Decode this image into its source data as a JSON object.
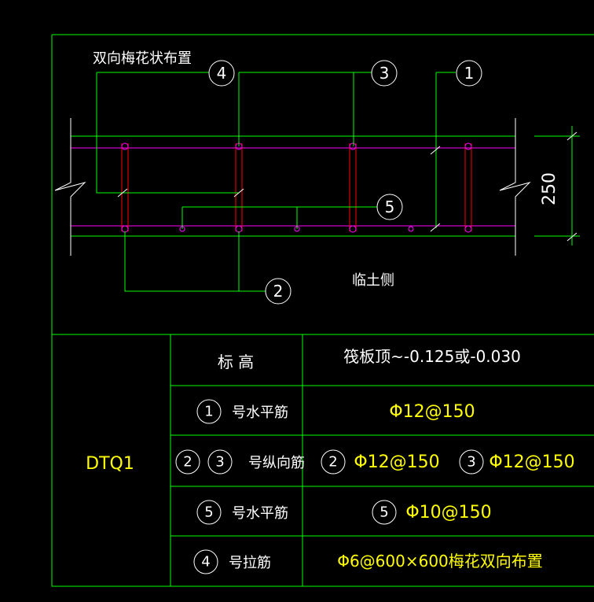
{
  "drawing": {
    "layout_note": "双向梅花状布置",
    "soil_side": "临土侧",
    "dimension": "250",
    "callouts": {
      "n1": "1",
      "n2": "2",
      "n3": "3",
      "n4": "4",
      "n5": "5"
    }
  },
  "table": {
    "id_label": "DTQ1",
    "rows": [
      {
        "left_label": "标  高",
        "value": "筏板顶~-0.125或-0.030"
      },
      {
        "left_num": "1",
        "left_label": "号水平筋",
        "value_num": "",
        "value": "Φ12@150"
      },
      {
        "left_num": "2",
        "left_num2": "3",
        "left_label": "号纵向筋",
        "value_num": "2",
        "value": "Φ12@150",
        "value_num2": "3",
        "value2": "Φ12@150"
      },
      {
        "left_num": "5",
        "left_label": "号水平筋",
        "value_num": "5",
        "value": "Φ10@150"
      },
      {
        "left_num": "4",
        "left_label": "号拉筋",
        "value": "Φ6@600×600梅花双向布置"
      }
    ]
  },
  "colors": {
    "background": "#000000",
    "frame": "#00ff00",
    "text_white": "#ffffff",
    "text_yellow": "#ffff00",
    "rebar_red": "#ff0000",
    "rebar_magenta": "#ff00ff"
  }
}
